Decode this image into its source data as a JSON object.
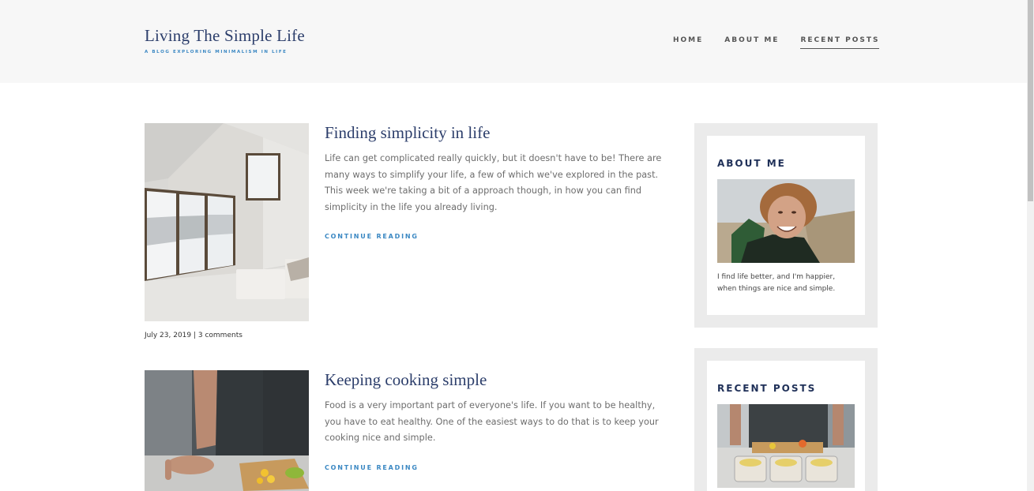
{
  "site": {
    "title": "Living The Simple Life",
    "tagline": "A blog exploring minimalism in life"
  },
  "nav": {
    "items": [
      {
        "label": "HOME",
        "active": false
      },
      {
        "label": "ABOUT ME",
        "active": false
      },
      {
        "label": "RECENT POSTS",
        "active": true
      }
    ]
  },
  "posts": [
    {
      "title": "Finding simplicity in life",
      "excerpt": "Life can get complicated really quickly, but it doesn't have to be! There are many ways to simplify your life, a few of which we've explored in the past. This week we're taking a bit of a approach though, in how you can find simplicity in the life you already living.",
      "continue_label": "CONTINUE READING",
      "meta": "July 23, 2019 | 3 comments",
      "image_icon": "room-photo"
    },
    {
      "title": "Keeping cooking simple",
      "excerpt": "Food is a very important part of everyone's life. If you want to be healthy, you have to eat healthy. One of the easiest ways to do that is to keep your cooking nice and simple.",
      "continue_label": "CONTINUE READING",
      "image_icon": "cooking-photo"
    }
  ],
  "sidebar": {
    "about": {
      "title": "ABOUT ME",
      "text": "I find life better, and I'm happier, when things are nice and simple.",
      "image_icon": "portrait-photo"
    },
    "recent": {
      "title": "RECENT POSTS",
      "image_icon": "meal-prep-photo"
    }
  },
  "colors": {
    "accent": "#3b88c3",
    "heading": "#2c3e6b",
    "header_bg": "#f7f7f7",
    "widget_bg": "#ebebeb"
  }
}
